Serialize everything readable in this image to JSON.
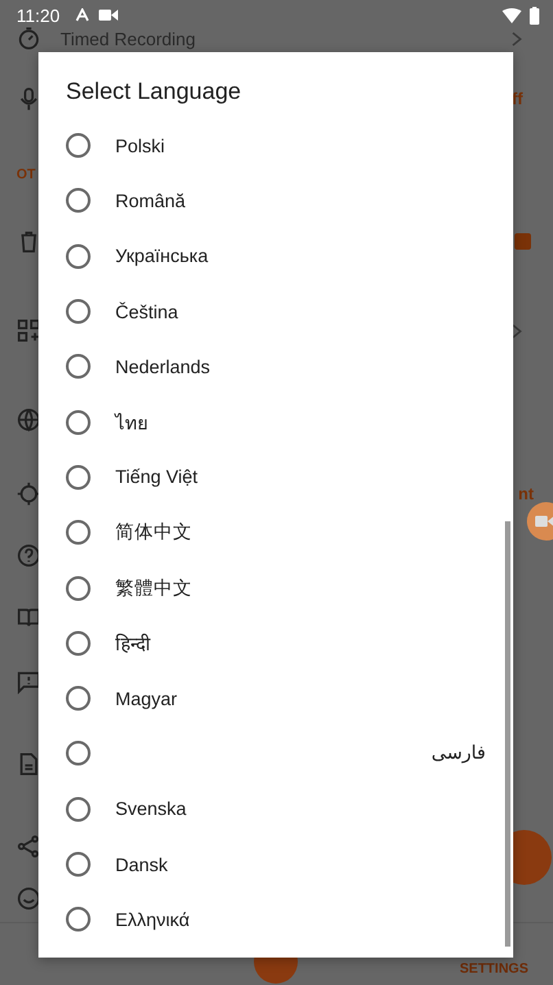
{
  "status_bar": {
    "time": "11:20"
  },
  "background_screen": {
    "timed_recording": "Timed Recording",
    "row_value_1": "ff",
    "section_header": "OT",
    "row_value_2": "nt",
    "toggle_checked": true,
    "bottom_tab": "SETTINGS"
  },
  "dialog": {
    "title": "Select Language",
    "options": [
      {
        "label": "Polski",
        "selected": false
      },
      {
        "label": "Română",
        "selected": false
      },
      {
        "label": "Українська",
        "selected": false
      },
      {
        "label": "Čeština",
        "selected": false
      },
      {
        "label": "Nederlands",
        "selected": false
      },
      {
        "label": "ไทย",
        "selected": false
      },
      {
        "label": "Tiếng Việt",
        "selected": false
      },
      {
        "label": "简体中文",
        "selected": false
      },
      {
        "label": "繁體中文",
        "selected": false
      },
      {
        "label": "हिन्दी",
        "selected": false
      },
      {
        "label": "Magyar",
        "selected": false
      },
      {
        "label": "فارسی",
        "selected": false
      },
      {
        "label": "Svenska",
        "selected": false
      },
      {
        "label": "Dansk",
        "selected": false
      },
      {
        "label": "Ελληνικά",
        "selected": false
      }
    ]
  }
}
